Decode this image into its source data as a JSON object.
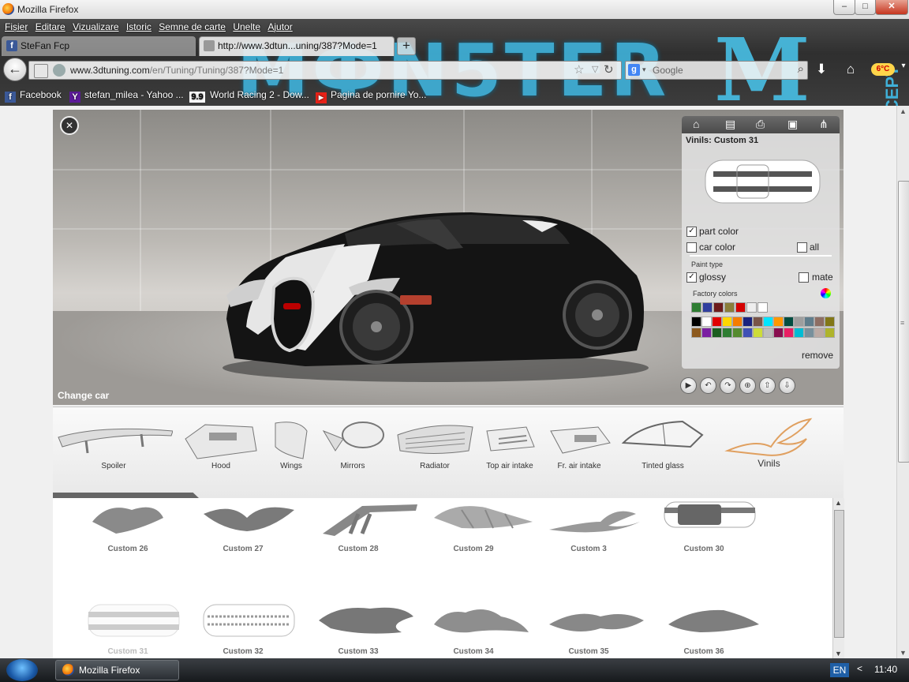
{
  "window": {
    "title": "Mozilla Firefox",
    "controls": [
      "–",
      "□",
      "✕"
    ]
  },
  "menu": [
    "Fișier",
    "Editare",
    "Vizualizare",
    "Istoric",
    "Semne de carte",
    "Unelte",
    "Ajutor"
  ],
  "header_art": {
    "word": "MФN5TER",
    "mark": "M",
    "side_text": "NCEPT",
    "accent": "#3fb0d8"
  },
  "tabs": [
    {
      "label": "SteFan Fcp",
      "active": false
    },
    {
      "label": "http://www.3dtun...uning/387?Mode=1",
      "active": true
    }
  ],
  "new_tab": "+",
  "url": {
    "domain": "www.3dtuning.com",
    "path": "/en/Tuning/Tuning/387?Mode=1"
  },
  "search": {
    "engine": "g",
    "placeholder": "Google"
  },
  "weather": {
    "temp": "6°C"
  },
  "bookmarks": [
    {
      "label": "Facebook",
      "icon": "f",
      "color": "#3b5998"
    },
    {
      "label": "stefan_milea - Yahoo ...",
      "icon": "Y",
      "color": "#5c1a99"
    },
    {
      "label": "",
      "icon": "9.9",
      "color": "#ffffff"
    },
    {
      "label": "World Racing 2 - Dow...",
      "icon": "",
      "color": "#7a7a7a"
    },
    {
      "label": "Pagina de pornire Yo...",
      "icon": "▶",
      "color": "#e62117"
    }
  ],
  "stage": {
    "change_car": "Change car"
  },
  "vinyl_panel": {
    "title": "Vinils: Custom 31",
    "part_color": "part color",
    "part_color_checked": true,
    "car_color": "car color",
    "car_color_checked": false,
    "all": "all",
    "all_checked": false,
    "paint_type": "Paint type",
    "glossy": "glossy",
    "glossy_checked": true,
    "mate": "mate",
    "mate_checked": false,
    "factory_colors": "Factory colors",
    "factory_swatches": [
      "#2e7d32",
      "#303f9f",
      "#6d1b1b",
      "#8a7e3a",
      "#d50000",
      "#eeeeee",
      "#ffffff"
    ],
    "palette": [
      "#000000",
      "#ffffff",
      "#e00000",
      "#ffd600",
      "#f57c00",
      "#1a237e",
      "#795548",
      "#00e5ff",
      "#ff9800",
      "#004d40",
      "#9e9e9e",
      "#607d8b",
      "#8d6e63",
      "#827717",
      "#8d5a1e",
      "#7b1fa2",
      "#1b5e20",
      "#2e7d32",
      "#558b2f",
      "#3f51b5",
      "#cddc39",
      "#bdbdbd",
      "#880e4f",
      "#e91e63",
      "#00bcd4",
      "#78909c",
      "#bcaaa4",
      "#afb42b"
    ],
    "remove": "remove"
  },
  "controls": [
    "▶",
    "↶",
    "↷",
    "⊕",
    "⇧",
    "⇩"
  ],
  "parts": [
    {
      "label": "Spoiler",
      "selected": false
    },
    {
      "label": "Hood",
      "selected": false
    },
    {
      "label": "Wings",
      "selected": false
    },
    {
      "label": "Mirrors",
      "selected": false
    },
    {
      "label": "Radiator",
      "selected": false
    },
    {
      "label": "Top air intake",
      "selected": false
    },
    {
      "label": "Fr. air intake",
      "selected": false
    },
    {
      "label": "Tinted glass",
      "selected": false
    },
    {
      "label": "Vinils",
      "selected": true
    }
  ],
  "vinyls": [
    {
      "label": "Custom 26"
    },
    {
      "label": "Custom 27"
    },
    {
      "label": "Custom 28"
    },
    {
      "label": "Custom 29"
    },
    {
      "label": "Custom 3"
    },
    {
      "label": "Custom 30"
    },
    {
      "label": "Custom 31",
      "faded": true
    },
    {
      "label": "Custom 32"
    },
    {
      "label": "Custom 33"
    },
    {
      "label": "Custom 34"
    },
    {
      "label": "Custom 35"
    },
    {
      "label": "Custom 36"
    }
  ],
  "taskbar": {
    "app": "Mozilla Firefox",
    "lang": "EN",
    "arrow": "<",
    "time": "11:40"
  }
}
